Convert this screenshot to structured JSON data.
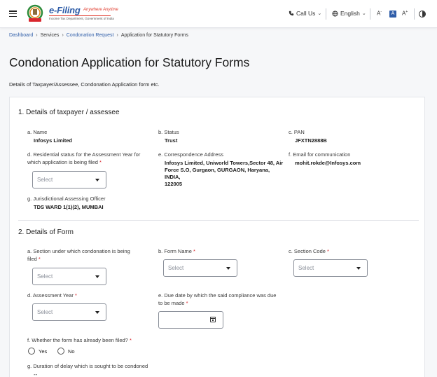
{
  "header": {
    "logo_title": "e-Filing",
    "logo_tagline": "Anywhere Anytime",
    "logo_sub": "Income Tax Department, Government of India",
    "call_us": "Call Us",
    "language": "English",
    "font_decrease": "A",
    "font_default": "A",
    "font_increase": "A",
    "icons": [
      "hamburger-icon",
      "phone-icon",
      "globe-icon",
      "contrast-icon"
    ]
  },
  "breadcrumb": [
    "Dashboard",
    "Services",
    "Condonation Request",
    "Application for Statutory Forms"
  ],
  "page": {
    "title": "Condonation Application for Statutory Forms",
    "subtitle": "Details of Taxpayer/Assessee, Condonation Application form etc."
  },
  "section1": {
    "title": "1. Details of taxpayer / assessee",
    "name_label": "a. Name",
    "name_value": "Infosys Limited",
    "status_label": "b. Status",
    "status_value": "Trust",
    "pan_label": "c. PAN",
    "pan_value": "JFXTN2888B",
    "residential_label_1": "d. Residential status for the Assessment Year for",
    "residential_label_2": "which application is being filed",
    "residential_placeholder": "Select",
    "address_label": "e. Correspondence Address",
    "address_line1": "Infosys Limited, Uniworld Towers,Sector 48, Air",
    "address_line2": "Force S.O, Gurgaon, GURGAON, Haryana, INDIA,",
    "address_line3": "122005",
    "email_label": "f. Email for communication",
    "email_value": "mohit.rokde@Infosys.com",
    "jao_label": "g. Jurisdictional Assessing Officer",
    "jao_value": "TDS WARD 1(1)(2), MUMBAI"
  },
  "section2": {
    "title": "2. Details of Form",
    "section_label_1": "a. Section under which condonation is being",
    "section_label_2": "filed",
    "section_placeholder": "Select",
    "form_name_label": "b. Form Name",
    "form_name_placeholder": "Select",
    "section_code_label": "c. Section Code",
    "section_code_placeholder": "Select",
    "ay_label": "d. Assessment Year",
    "ay_placeholder": "Select",
    "due_date_label_1": "e. Due date by which the said compliance was due",
    "due_date_label_2": "to be made",
    "filed_label": "f. Whether the form has already been filed?",
    "yes_label": "Yes",
    "no_label": "No",
    "delay_label": "g. Duration of delay which is sought to be condoned",
    "delay_value": "--"
  },
  "required_mark": "*"
}
